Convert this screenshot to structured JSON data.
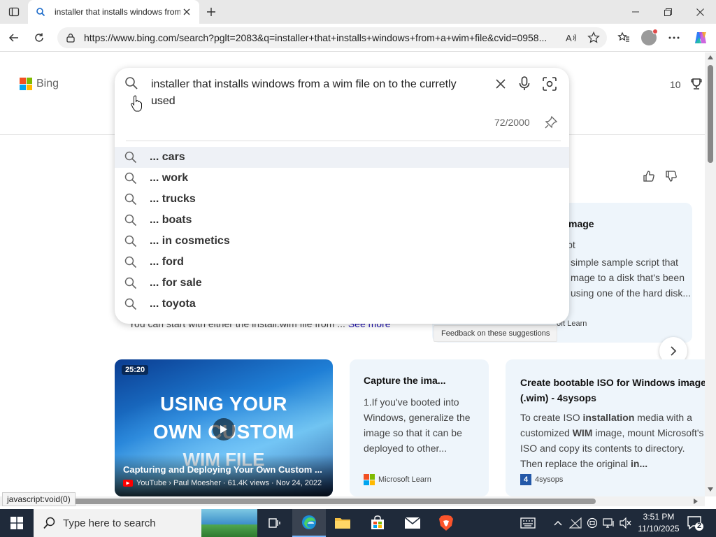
{
  "browser": {
    "tab_title": "installer that installs windows from a wim file",
    "url": "https://www.bing.com/search?pglt=2083&q=installer+that+installs+windows+from+a+wim+file&cvid=0958..."
  },
  "bing": {
    "logo_text": "Bing",
    "rewards_count": "10"
  },
  "search": {
    "query": "installer that installs windows from a wim file on to the curretly used",
    "char_counter": "72/2000",
    "suggestions": [
      {
        "prefix": "... ",
        "text": "cars"
      },
      {
        "prefix": "... ",
        "text": "work"
      },
      {
        "prefix": "... ",
        "text": "trucks"
      },
      {
        "prefix": "... ",
        "text": "boats"
      },
      {
        "prefix": "... ",
        "text": "in cosmetics"
      },
      {
        "prefix": "... ",
        "text": "ford"
      },
      {
        "prefix": "... ",
        "text": "for sale"
      },
      {
        "prefix": "... ",
        "text": "toyota"
      }
    ],
    "feedback": "Feedback on these suggestions"
  },
  "background": {
    "partial_title": "mage",
    "partial_line1": "ipt",
    "partial_body": "simple sample script that mage to a disk that's been using one of the hard disk...",
    "partial_source": "oft Learn",
    "answer_text": "You can start with either the install.wim file from ...",
    "see_more": "See more"
  },
  "video": {
    "duration": "25:20",
    "thumb_line1": "USING YOUR",
    "thumb_line2": "OWN CUSTOM",
    "thumb_line3": "WIM FILE",
    "title": "Capturing and Deploying Your Own Custom ...",
    "meta": "YouTube › Paul Moesher · 61.4K views · Nov 24, 2022"
  },
  "card2": {
    "title": "Capture the ima...",
    "body": "1.If you've booted into Windows, generalize the image so that it can be deployed to other...",
    "source": "Microsoft Learn"
  },
  "card3": {
    "title": "Create bootable ISO for Windows image (.wim) - 4sysops",
    "body_pre": "To create ISO ",
    "body_b1": "installation",
    "body_mid": " media with a customized ",
    "body_b2": "WIM",
    "body_post": " image, mount Microsoft's ISO and copy its contents to directory. Then replace the original ",
    "body_b3": "in...",
    "source_icon": "4",
    "source": "4sysops"
  },
  "status_bar": "javascript:void(0)",
  "taskbar": {
    "search_placeholder": "Type here to search",
    "time": "3:51 PM",
    "date": "11/10/2025",
    "notification_count": "2"
  },
  "colors": {
    "bing_red": "#f25022",
    "bing_green": "#7fba00",
    "bing_blue": "#00a4ef",
    "bing_yellow": "#ffb900",
    "taskbar": "#1f2a3a",
    "link": "#1a0dab"
  }
}
